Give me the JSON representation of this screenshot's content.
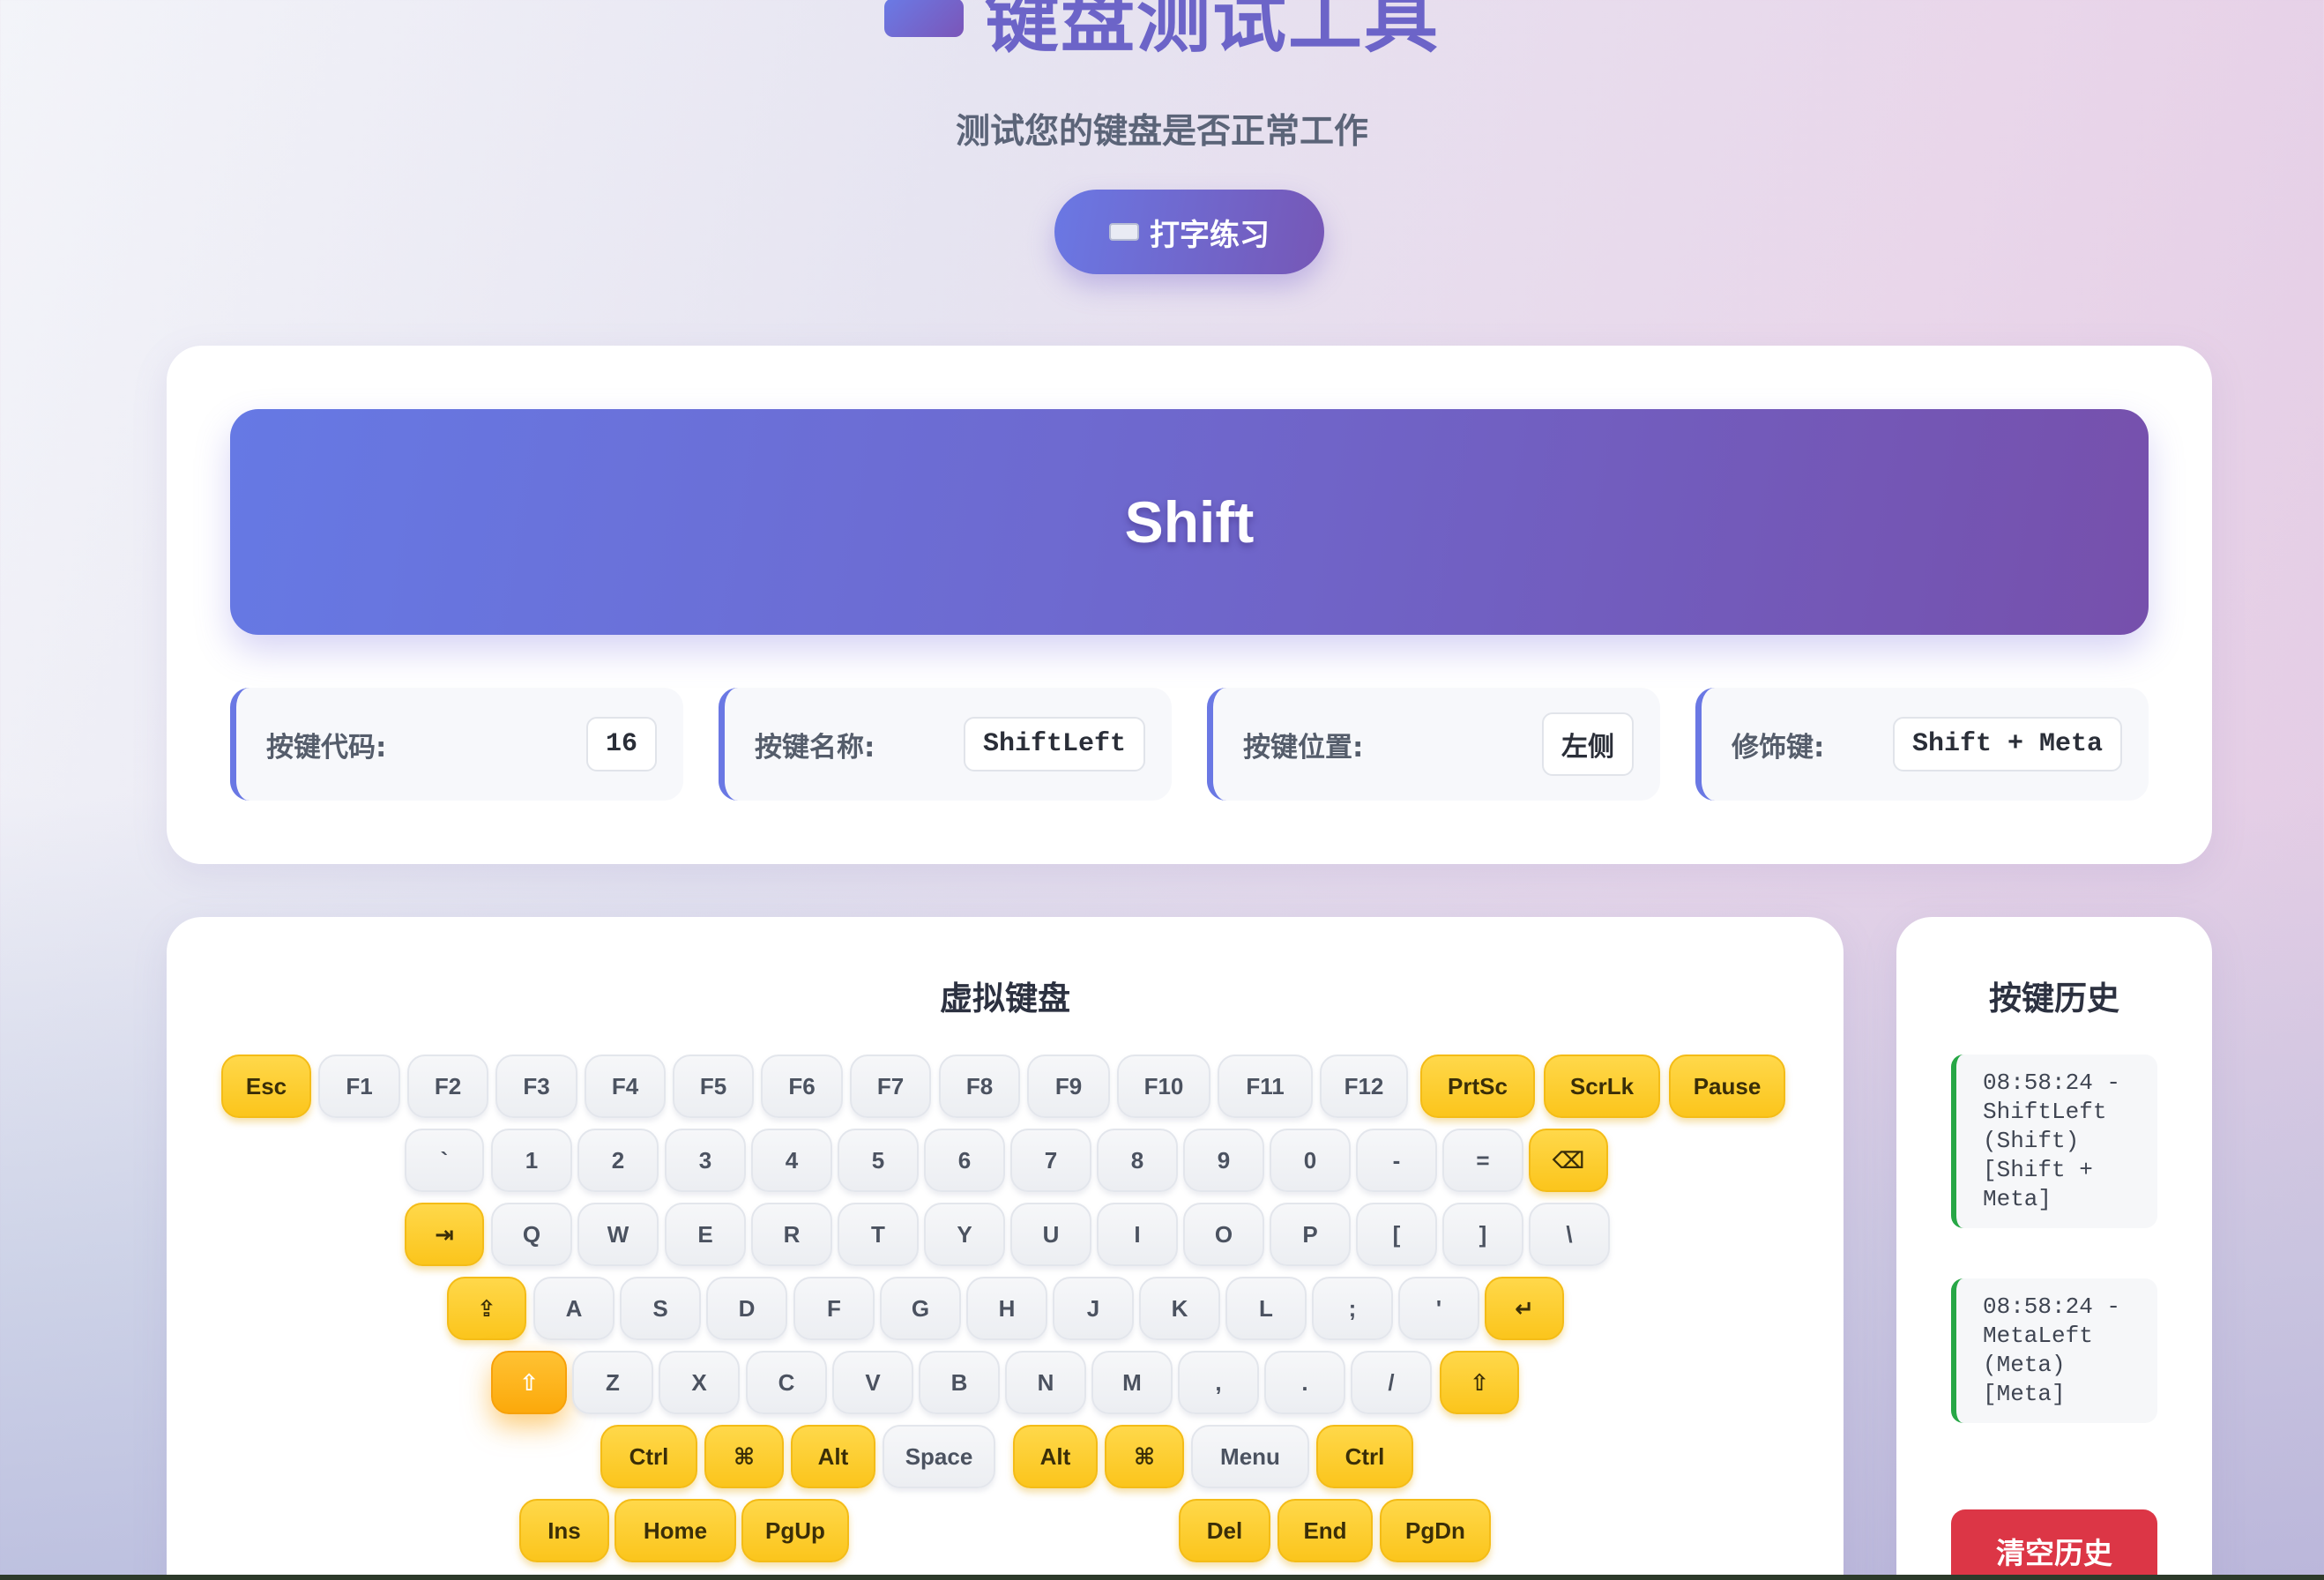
{
  "header": {
    "title": "键盘测试工具",
    "subtitle": "测试您的键盘是否正常工作",
    "typing_button": "打字练习"
  },
  "display": {
    "key": "Shift",
    "info": [
      {
        "label": "按键代码:",
        "value": "16"
      },
      {
        "label": "按键名称:",
        "value": "ShiftLeft"
      },
      {
        "label": "按键位置:",
        "value": "左侧"
      },
      {
        "label": "修饰键:",
        "value": "Shift + Meta"
      }
    ]
  },
  "keyboard": {
    "title": "虚拟键盘",
    "active_key": "⇧",
    "rows": [
      [
        "Esc",
        "F1",
        "F2",
        "F3",
        "F4",
        "F5",
        "F6",
        "F7",
        "F8",
        "F9",
        "F10",
        "F11",
        "F12",
        "PrtSc",
        "ScrLk",
        "Pause"
      ],
      [
        "`",
        "1",
        "2",
        "3",
        "4",
        "5",
        "6",
        "7",
        "8",
        "9",
        "0",
        "-",
        "=",
        "⌫"
      ],
      [
        "⇥",
        "Q",
        "W",
        "E",
        "R",
        "T",
        "Y",
        "U",
        "I",
        "O",
        "P",
        "[",
        "]",
        "\\"
      ],
      [
        "⇪",
        "A",
        "S",
        "D",
        "F",
        "G",
        "H",
        "J",
        "K",
        "L",
        ";",
        "'",
        "↵"
      ],
      [
        "⇧",
        "Z",
        "X",
        "C",
        "V",
        "B",
        "N",
        "M",
        ",",
        ".",
        "/",
        "⇧"
      ],
      [
        "Ctrl",
        "⌘",
        "Alt",
        "Space",
        "Alt",
        "⌘",
        "Menu",
        "Ctrl"
      ],
      [
        "Ins",
        "Home",
        "PgUp",
        "Del",
        "End",
        "PgDn"
      ]
    ]
  },
  "history": {
    "title": "按键历史",
    "items": [
      "08:58:24 - ShiftLeft (Shift) [Shift + Meta]",
      "08:58:24 - MetaLeft (Meta) [Meta]"
    ],
    "clear_button": "清空历史"
  },
  "colors": {
    "accent": "#6a78e4",
    "special_key": "#fbc51c",
    "active_key": "#fca90b",
    "history_border": "#27a746",
    "danger": "#dc3646"
  }
}
